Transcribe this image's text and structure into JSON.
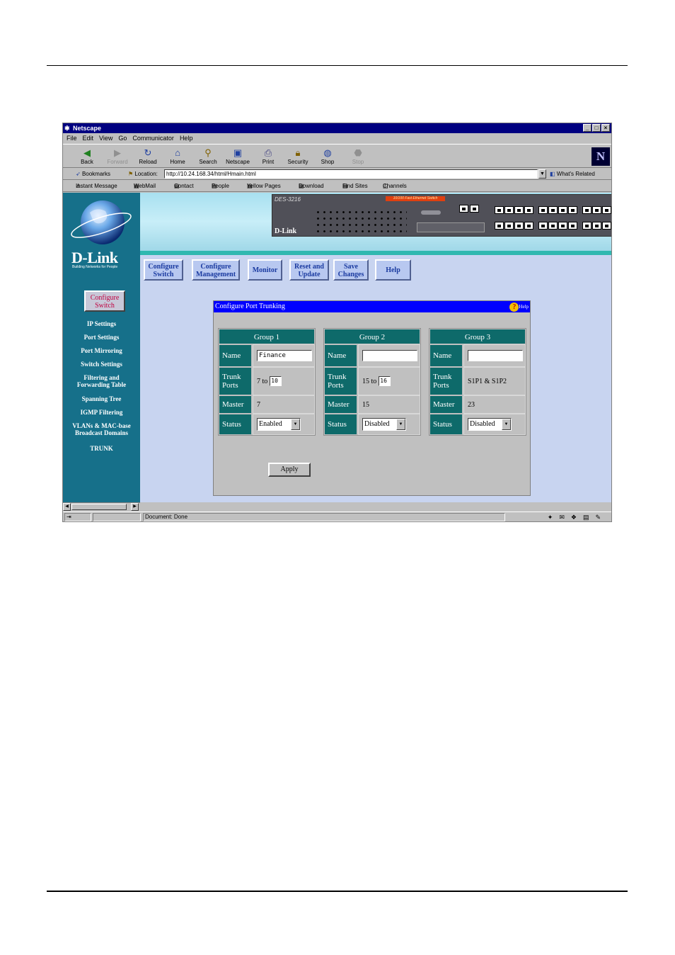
{
  "window": {
    "title": "Netscape",
    "menu": [
      "File",
      "Edit",
      "View",
      "Go",
      "Communicator",
      "Help"
    ]
  },
  "toolbar": {
    "buttons": [
      "Back",
      "Forward",
      "Reload",
      "Home",
      "Search",
      "Netscape",
      "Print",
      "Security",
      "Shop",
      "Stop"
    ]
  },
  "location": {
    "bookmarks_label": "Bookmarks",
    "label": "Location:",
    "url": "http://10.24.168.34/html/Hmain.html",
    "related_label": "What's Related"
  },
  "personal_toolbar": [
    "Instant Message",
    "WebMail",
    "Contact",
    "People",
    "Yellow Pages",
    "Download",
    "Find Sites",
    "Channels"
  ],
  "brand": {
    "logo": "D-Link",
    "tagline": "Building Networks for People"
  },
  "switch_panel": {
    "model": "DES-3216",
    "orange_label": "10/100 Fast Ethernet Switch",
    "brand": "D-Link"
  },
  "sidebar": {
    "active_button": "Configure Switch",
    "items": [
      "IP Settings",
      "Port Settings",
      "Port Mirroring",
      "Switch Settings",
      "Filtering and Forwarding Table",
      "Spanning Tree",
      "IGMP Filtering",
      "VLANs & MAC-base Broadcast Domains",
      "TRUNK"
    ]
  },
  "nav": {
    "configure_switch": "Configure Switch",
    "configure_management": "Configure Management",
    "monitor": "Monitor",
    "reset_update": "Reset and Update",
    "save_changes": "Save Changes",
    "help": "Help"
  },
  "panel": {
    "title": "Configure Port Trunking",
    "help_label": "Help",
    "labels": {
      "name": "Name",
      "trunk_ports": "Trunk Ports",
      "master": "Master",
      "status": "Status"
    },
    "groups": [
      {
        "title": "Group 1",
        "name": "Finance",
        "trunk_from": "7 to",
        "trunk_to": "10",
        "master": "7",
        "status": "Enabled"
      },
      {
        "title": "Group 2",
        "name": "",
        "trunk_from": "15 to",
        "trunk_to": "16",
        "master": "15",
        "status": "Disabled"
      },
      {
        "title": "Group 3",
        "name": "",
        "trunk_text": "S1P1 & S1P2",
        "master": "23",
        "status": "Disabled"
      }
    ],
    "apply_label": "Apply"
  },
  "status": {
    "text": "Document: Done"
  }
}
